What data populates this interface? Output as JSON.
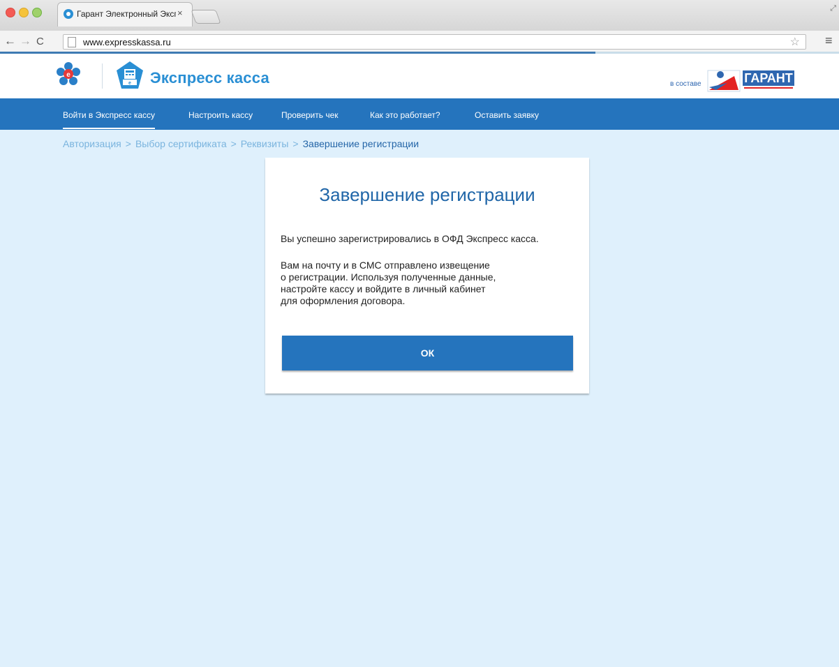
{
  "browser": {
    "tab_title": "Гарант Электронный Экспр",
    "url": "www.expresskassa.ru",
    "page_load_progress": 0.71
  },
  "header": {
    "brand_name": "Экспресс касса",
    "partner_label": "в составе"
  },
  "nav": {
    "items": [
      {
        "label": "Войти в Экспресс кассу",
        "active": true
      },
      {
        "label": "Настроить кассу"
      },
      {
        "label": "Проверить чек"
      },
      {
        "label": "Как это работает?"
      },
      {
        "label": "Оставить заявку"
      }
    ]
  },
  "breadcrumb": {
    "separator": ">",
    "steps": [
      "Авторизация",
      "Выбор сертификата",
      "Реквизиты"
    ],
    "current": "Завершение регистрации"
  },
  "card": {
    "title": "Завершение регистрации",
    "paragraph1": "Вы успешно зарегистрировались в ОФД Экспресс касса.",
    "paragraph2": "Вам на почту и в СМС отправлено извещение\nо регистрации. Используя полученные данные,\nнастройте кассу и войдите в личный кабинет\nдля оформления договора.",
    "ok_label": "ОК"
  },
  "colors": {
    "nav_bg": "#2574bd",
    "content_bg": "#dff0fc",
    "brand": "#2a8fd4",
    "title": "#2066a8"
  }
}
